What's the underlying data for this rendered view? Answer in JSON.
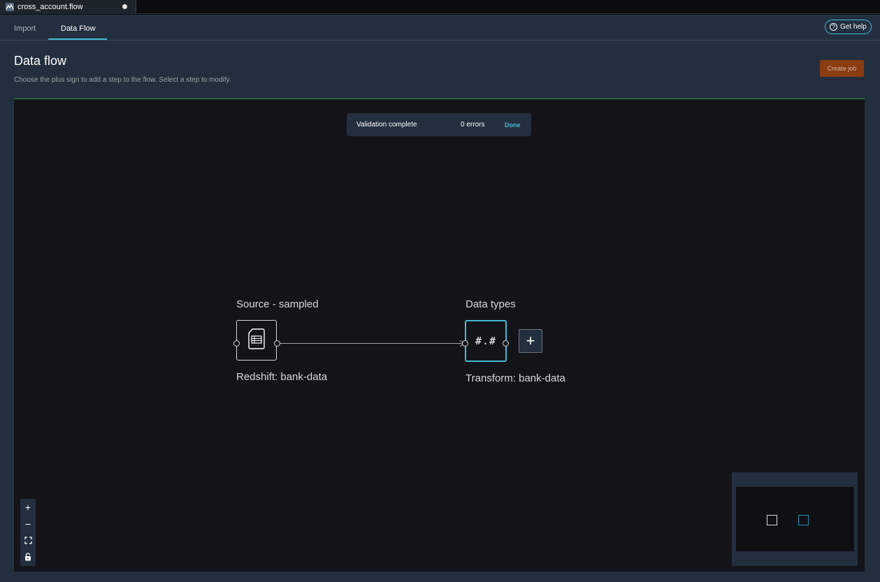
{
  "tab": {
    "file_name": "cross_account.flow",
    "icon": "flow-file-icon"
  },
  "subnav": {
    "tabs": [
      {
        "label": "Import"
      },
      {
        "label": "Data Flow"
      }
    ],
    "active_tab": "Data Flow",
    "help_label": "Get help"
  },
  "header": {
    "title": "Data flow",
    "description": "Choose the plus sign to add a step to the flow. Select a step to modify.",
    "create_job_label": "Create job"
  },
  "toast": {
    "message": "Validation complete",
    "errors": "0 errors",
    "done_label": "Done"
  },
  "nodes": [
    {
      "title": "Source - sampled",
      "subtitle": "Redshift: bank-data",
      "icon": "table-file-icon"
    },
    {
      "title": "Data types",
      "subtitle": "Transform: bank-data",
      "icon": "data-type-icon",
      "glyph": "#.#"
    }
  ],
  "add_step": {
    "icon": "plus-icon",
    "glyph": "+"
  },
  "zoom_controls": {
    "zoom_in": "+",
    "zoom_out": "−",
    "fit_icon": "fit-view-icon",
    "lock_icon": "lock-icon"
  },
  "colors": {
    "accent": "#44b9d6",
    "create_job_bg": "#8a3c13",
    "panel_bg": "#232f3e",
    "canvas_bg": "#131419"
  }
}
